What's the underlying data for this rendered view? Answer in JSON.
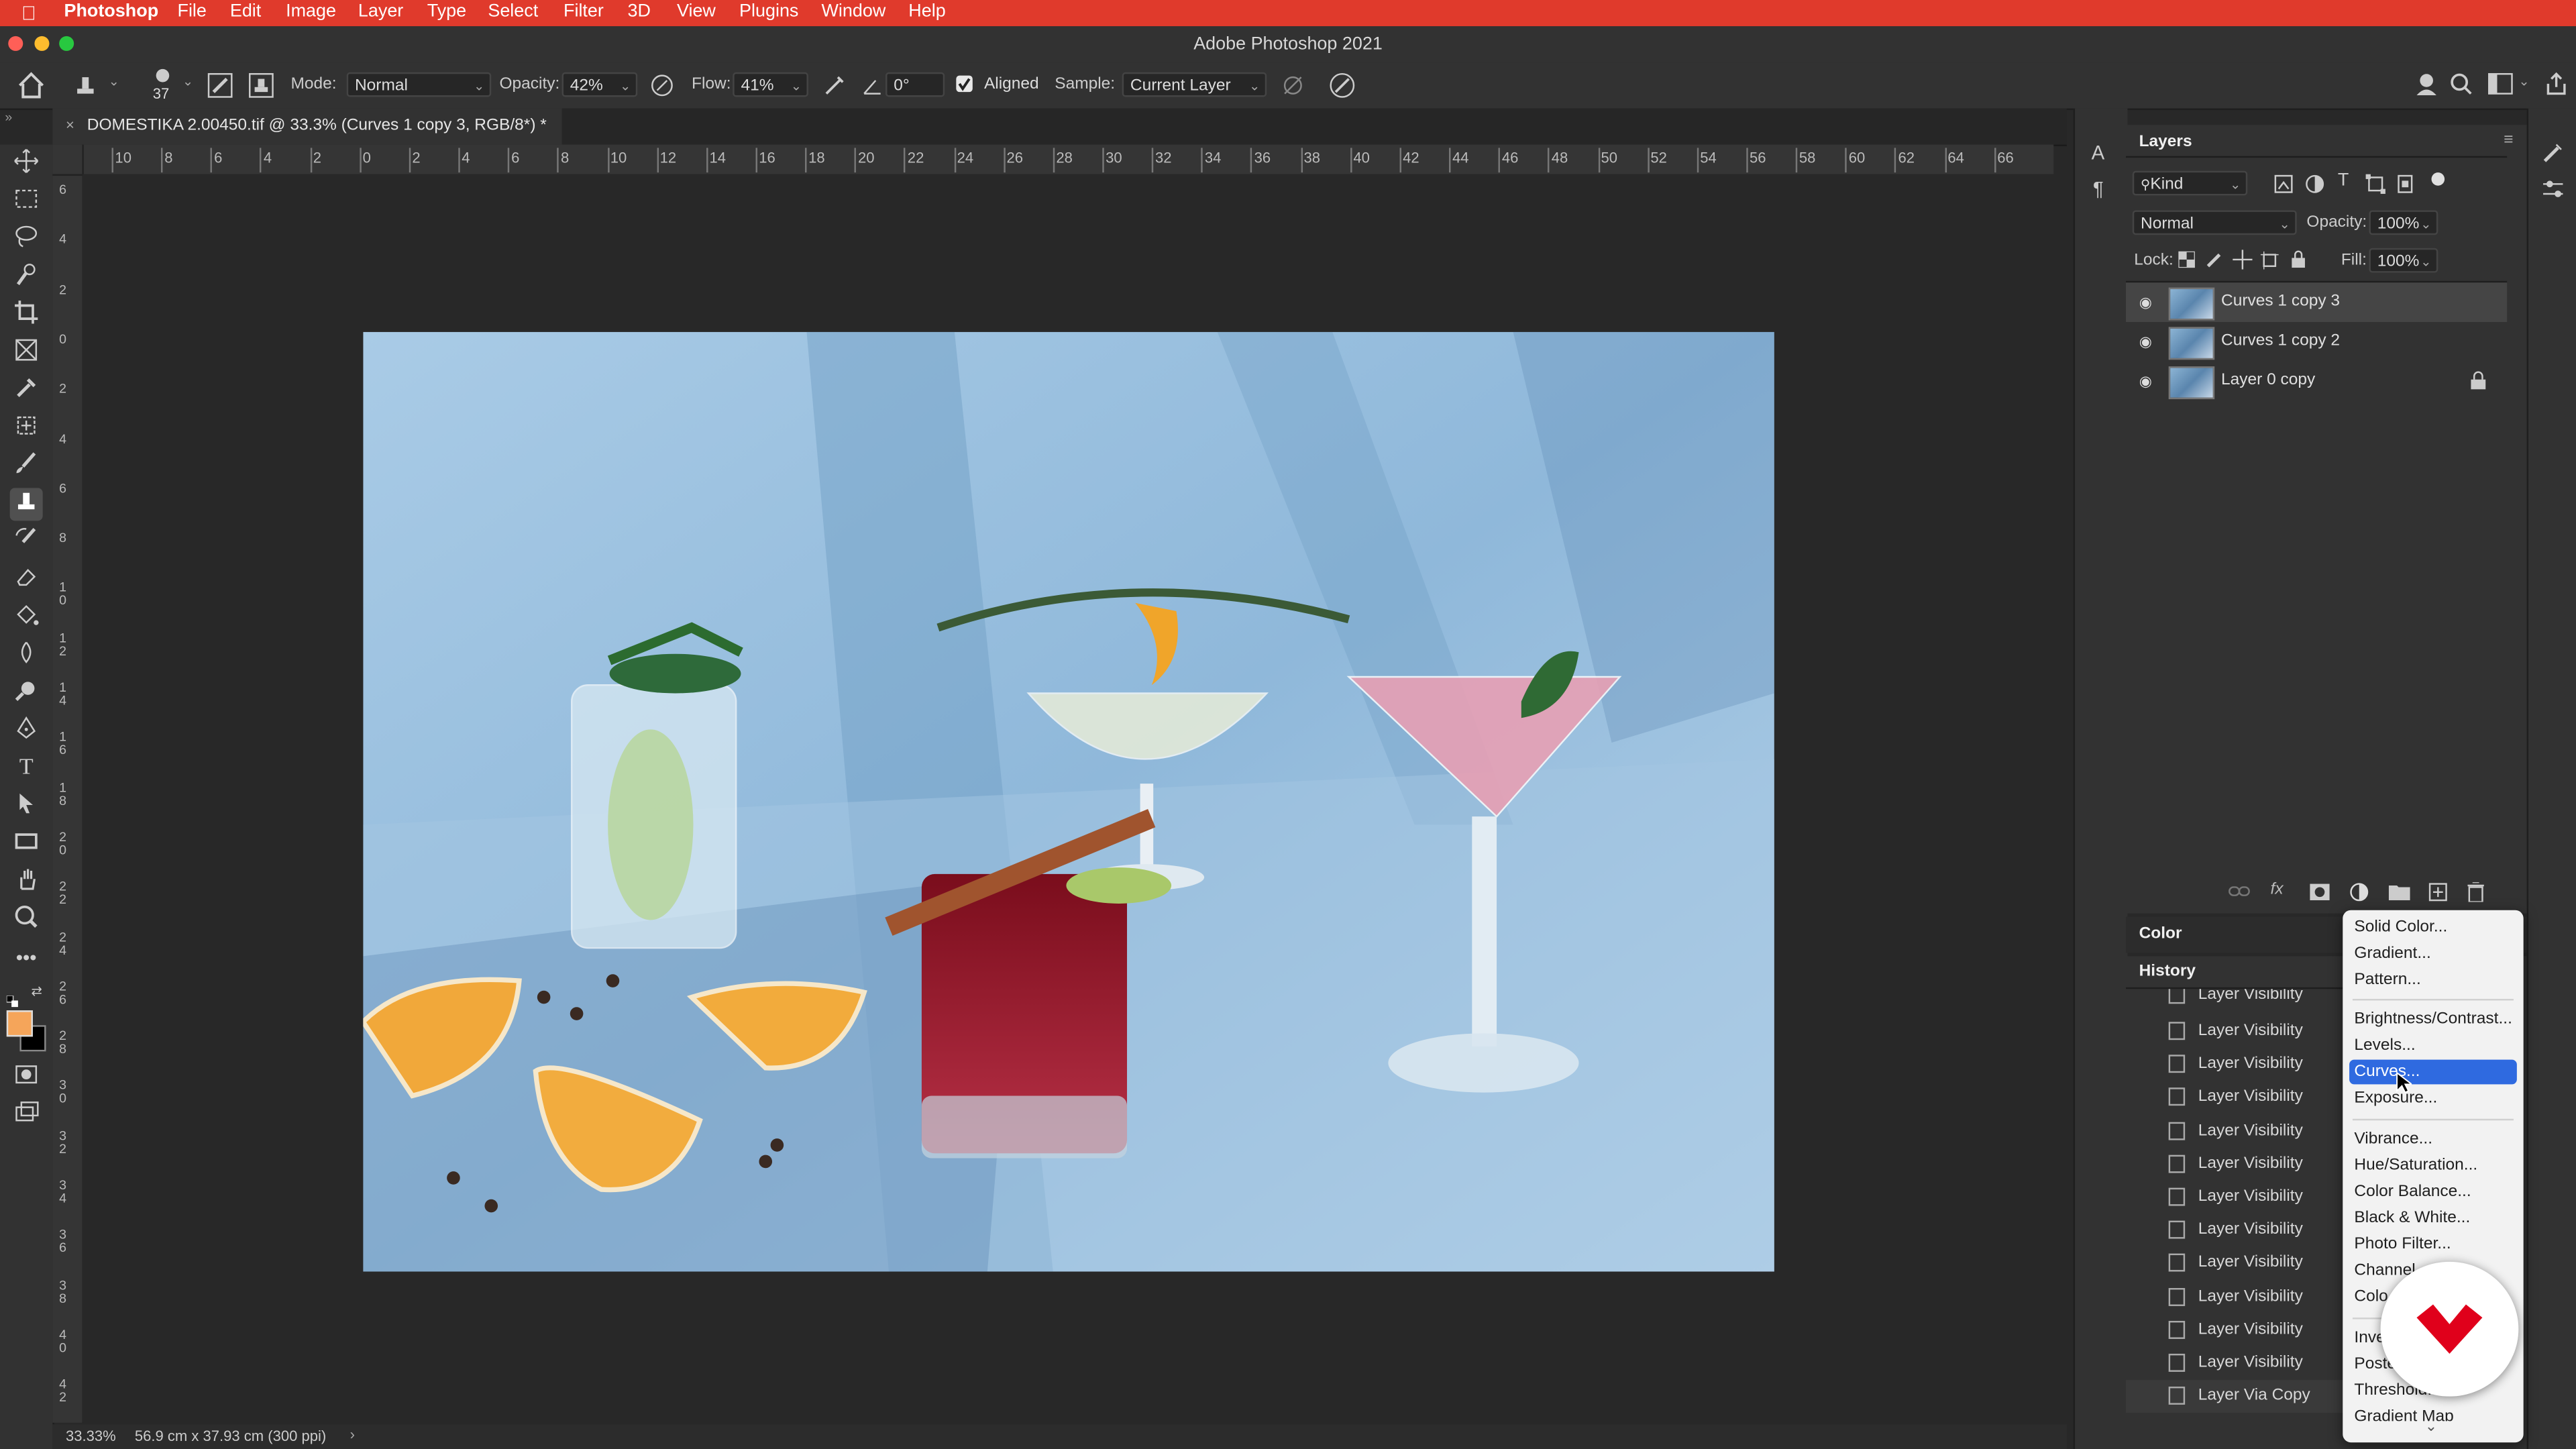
{
  "menubar": {
    "app": "Photoshop",
    "items": [
      "File",
      "Edit",
      "Image",
      "Layer",
      "Type",
      "Select",
      "Filter",
      "3D",
      "View",
      "Plugins",
      "Window",
      "Help"
    ]
  },
  "window": {
    "title": "Adobe Photoshop 2021"
  },
  "options": {
    "brush_size": "37",
    "mode_label": "Mode:",
    "mode_value": "Normal",
    "opacity_label": "Opacity:",
    "opacity_value": "42%",
    "flow_label": "Flow:",
    "flow_value": "41%",
    "angle_value": "0°",
    "aligned_label": "Aligned",
    "aligned_checked": true,
    "sample_label": "Sample:",
    "sample_value": "Current Layer"
  },
  "document": {
    "tab_title": "DOMESTIKA 2.00450.tif @ 33.3% (Curves 1 copy 3, RGB/8*) *",
    "zoom": "33.33%",
    "size_info": "56.9 cm x 37.93 cm (300 ppi)"
  },
  "ruler_top": [
    "10",
    "8",
    "6",
    "4",
    "2",
    "0",
    "2",
    "4",
    "6",
    "8",
    "10",
    "12",
    "14",
    "16",
    "18",
    "20",
    "22",
    "24",
    "26",
    "28",
    "30",
    "32",
    "34",
    "36",
    "38",
    "40",
    "42",
    "44",
    "46",
    "48",
    "50",
    "52",
    "54",
    "56",
    "58",
    "60",
    "62",
    "64",
    "66"
  ],
  "ruler_left": [
    "6",
    "4",
    "2",
    "0",
    "2",
    "4",
    "6",
    "8",
    "1 0",
    "1 2",
    "1 4",
    "1 6",
    "1 8",
    "2 0",
    "2 2",
    "2 4",
    "2 6",
    "2 8",
    "3 0",
    "3 2",
    "3 4",
    "3 6",
    "3 8",
    "4 0",
    "4 2"
  ],
  "layers_panel": {
    "title": "Layers",
    "filter_kind": "Kind",
    "blend_mode": "Normal",
    "opacity_label": "Opacity:",
    "opacity_value": "100%",
    "lock_label": "Lock:",
    "fill_label": "Fill:",
    "fill_value": "100%",
    "layers": [
      {
        "name": "Curves 1 copy 3",
        "selected": true,
        "locked": false
      },
      {
        "name": "Curves 1 copy 2",
        "selected": false,
        "locked": false
      },
      {
        "name": "Layer 0 copy",
        "selected": false,
        "locked": true
      }
    ]
  },
  "color_panel": {
    "title": "Color"
  },
  "history_panel": {
    "title": "History",
    "items": [
      "Layer Visibility",
      "Layer Visibility",
      "Layer Visibility",
      "Layer Visibility",
      "Layer Visibility",
      "Layer Visibility",
      "Layer Visibility",
      "Layer Visibility",
      "Layer Visibility",
      "Layer Visibility",
      "Layer Visibility",
      "Layer Visibility",
      "Layer Visibility",
      "Layer Via Copy"
    ]
  },
  "adjustment_menu": {
    "items": [
      "Solid Color...",
      "Gradient...",
      "Pattern...",
      "Brightness/Contrast...",
      "Levels...",
      "Curves...",
      "Exposure...",
      "Vibrance...",
      "Hue/Saturation...",
      "Color Balance...",
      "Black & White...",
      "Photo Filter...",
      "Channel",
      "Colo",
      "Inve",
      "Poste",
      "Threshold...",
      "Gradient Map"
    ],
    "highlighted": "Curves..."
  },
  "colors": {
    "menubar": "#e03a2c",
    "highlight": "#2f6ae0",
    "foreground_swatch": "#f5a55a",
    "background_swatch": "#000000",
    "brand_mark": "#e0001b"
  }
}
